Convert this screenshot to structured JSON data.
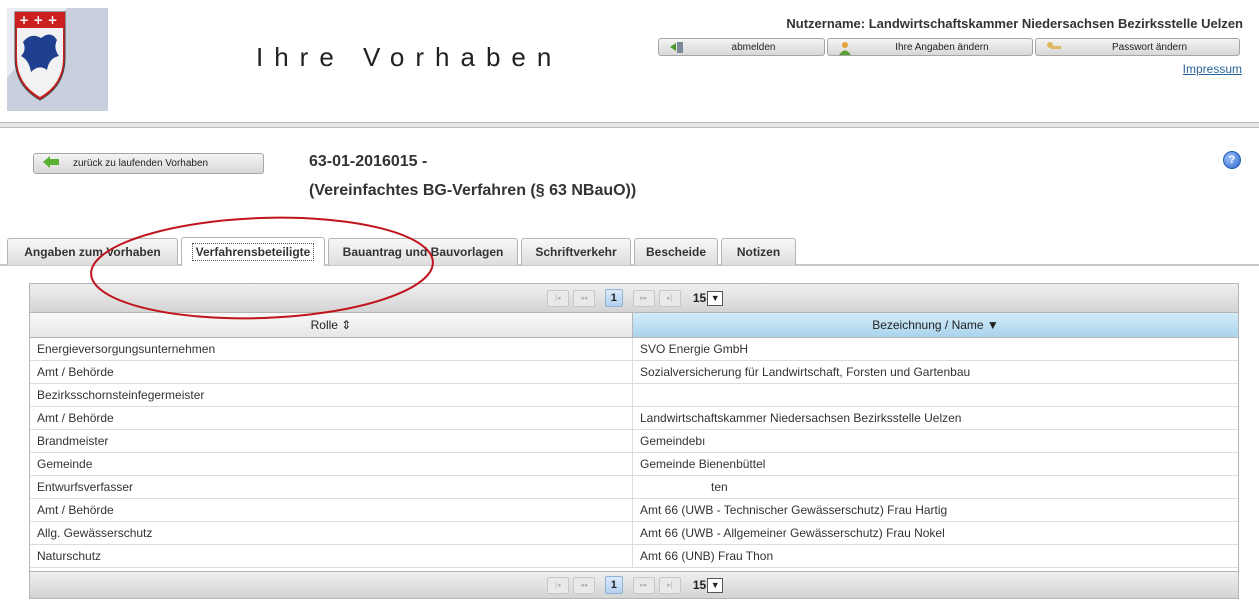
{
  "header": {
    "title": "Ihre Vorhaben",
    "user_label": "Nutzername: Landwirtschaftskammer Niedersachsen Bezirksstelle Uelzen",
    "logout_label": "abmelden",
    "edit_profile_label": "Ihre Angaben ändern",
    "change_password_label": "Passwort ändern",
    "impressum_label": "Impressum"
  },
  "project": {
    "back_label": "zurück zu laufenden Vorhaben",
    "id": "63-01-2016015 -",
    "type": "(Vereinfachtes BG-Verfahren (§ 63 NBauO))",
    "help": "?"
  },
  "tabs": [
    {
      "label": "Angaben zum Vorhaben"
    },
    {
      "label": "Verfahrensbeteiligte",
      "active": true
    },
    {
      "label": "Bauantrag und Bauvorlagen"
    },
    {
      "label": "Schriftverkehr"
    },
    {
      "label": "Bescheide"
    },
    {
      "label": "Notizen"
    }
  ],
  "pager": {
    "first": "|◂",
    "prev": "◂◂",
    "page": "1",
    "next": "▸▸",
    "last": "▸|",
    "page_size": "15",
    "dropdown": "▼"
  },
  "table": {
    "columns": [
      "Rolle ⇕",
      "Bezeichnung / Name ▼"
    ],
    "rows": [
      [
        "Energieversorgungsunternehmen",
        "SVO Energie GmbH"
      ],
      [
        "Amt / Behörde",
        "Sozialversicherung für Landwirtschaft, Forsten und Gartenbau"
      ],
      [
        "Bezirksschornsteinfegermeister",
        ""
      ],
      [
        "Amt / Behörde",
        "Landwirtschaftskammer Niedersachsen Bezirksstelle Uelzen"
      ],
      [
        "Brandmeister",
        "Gemeindebı"
      ],
      [
        "Gemeinde",
        "Gemeinde Bienenbüttel"
      ],
      [
        "Entwurfsverfasser",
        "ten"
      ],
      [
        "Amt / Behörde",
        "Amt 66 (UWB - Technischer Gewässerschutz) Frau Hartig"
      ],
      [
        "Allg. Gewässerschutz",
        "Amt 66 (UWB - Allgemeiner Gewässerschutz) Frau Nokel"
      ],
      [
        "Naturschutz",
        "Amt 66 (UNB) Frau Thon"
      ]
    ]
  },
  "colors": {
    "accent": "#2a6496",
    "annotation": "#c0141e",
    "header_sort_bg": "#a9d3ec"
  }
}
